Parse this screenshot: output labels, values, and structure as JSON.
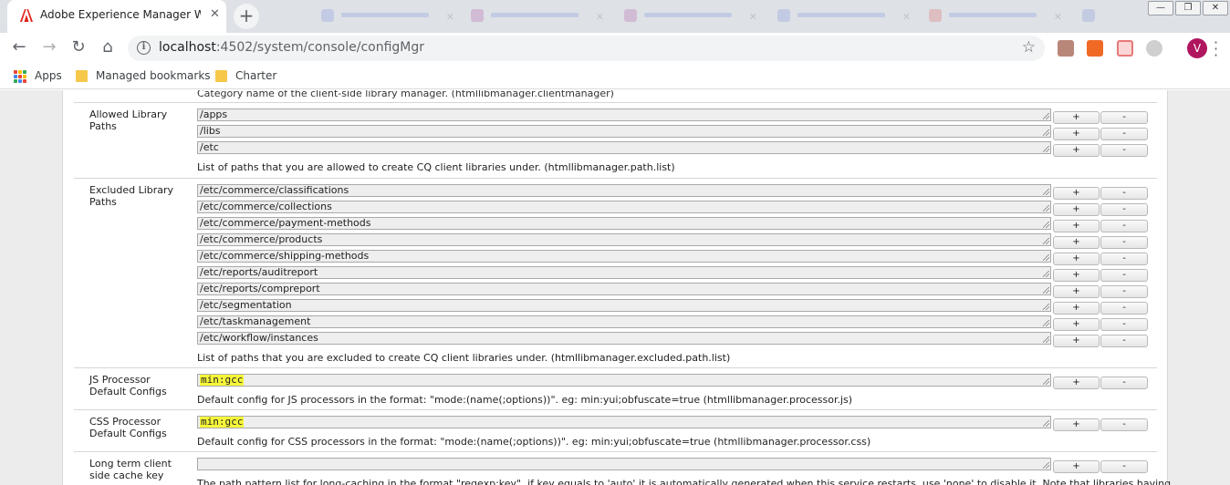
{
  "browser": {
    "tab_title": "Adobe Experience Manager Web",
    "tab_close": "✕",
    "new_tab": "+",
    "url_host": "localhost",
    "url_path": ":4502/system/console/configMgr",
    "avatar_letter": "V",
    "bookmarks": [
      "Apps",
      "Managed bookmarks",
      "Charter"
    ]
  },
  "colors": {
    "highlight": "#f7f73a",
    "adobe_red": "#e1251b",
    "avatar": "#b0155f"
  },
  "icons": [
    "adobe-icon",
    "back-arrow-icon",
    "forward-arrow-icon",
    "reload-icon",
    "home-icon",
    "info-icon",
    "star-icon",
    "acrobat-ext-icon",
    "aem-ext-icon",
    "cast-ext-icon",
    "sync-ext-icon",
    "kebab-menu-icon",
    "apps-grid-icon",
    "folder-icon",
    "resize-grip-icon"
  ],
  "config": {
    "top_cut_text": "Category name of the client-side library manager. (htmllibmanager.clientmanager)",
    "plus_label": "+",
    "minus_label": "-",
    "allowed": {
      "label": "Allowed Library Paths",
      "values": [
        "/apps",
        "/libs",
        "/etc"
      ],
      "description": "List of paths that you are allowed to create CQ client libraries under. (htmllibmanager.path.list)"
    },
    "excluded": {
      "label": "Excluded Library Paths",
      "values": [
        "/etc/commerce/classifications",
        "/etc/commerce/collections",
        "/etc/commerce/payment-methods",
        "/etc/commerce/products",
        "/etc/commerce/shipping-methods",
        "/etc/reports/auditreport",
        "/etc/reports/compreport",
        "/etc/segmentation",
        "/etc/taskmanagement",
        "/etc/workflow/instances"
      ],
      "description": "List of paths that you are excluded to create CQ client libraries under. (htmllibmanager.excluded.path.list)"
    },
    "js": {
      "label": "JS Processor Default Configs",
      "value": "min:gcc",
      "description": "Default config for JS processors in the format: \"mode:(name(;options))\". eg: min:yui;obfuscate=true (htmllibmanager.processor.js)"
    },
    "css": {
      "label": "CSS Processor Default Configs",
      "value": "min:gcc",
      "description": "Default config for CSS processors in the format: \"mode:(name(;options))\". eg: min:yui;obfuscate=true (htmllibmanager.processor.css)"
    },
    "longterm": {
      "label": "Long term client side cache key",
      "value": "",
      "description": "The path pattern list for long-caching in the format \"regexp:key\". if key equals to 'auto' it is automatically generated when this service restarts. use 'none' to disable it. Note that libraries having"
    }
  }
}
